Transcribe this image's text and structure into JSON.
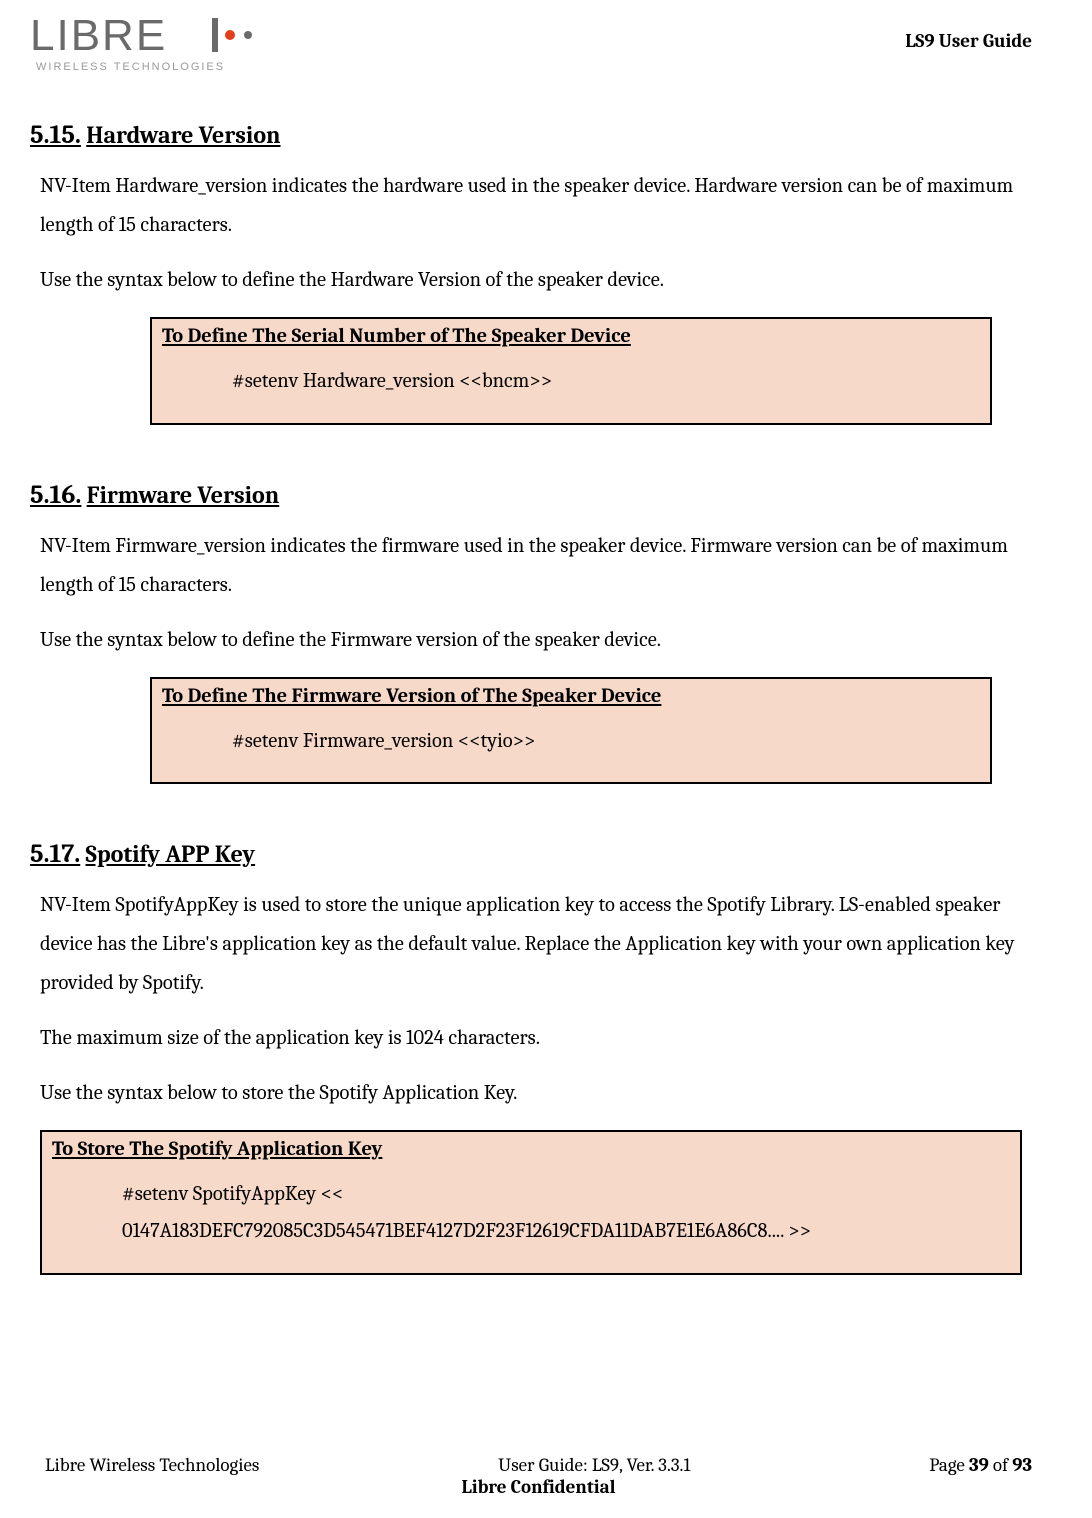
{
  "header": {
    "doc_title": "LS9 User Guide",
    "logo_text_main": "LIBRE",
    "logo_text_sub": "WIRELESS TECHNOLOGIES"
  },
  "sections": {
    "s515": {
      "num": "5.15.",
      "title": "Hardware Version",
      "para1": "NV-Item Hardware_version indicates the hardware used in the speaker device. Hardware version can be of maximum length of 15 characters.",
      "para2": "Use the syntax below to define the Hardware Version of the speaker device.",
      "box_title": "To Define The Serial Number of The Speaker Device",
      "box_cmd": "#setenv Hardware_version <<bncm>>"
    },
    "s516": {
      "num": "5.16.",
      "title": "Firmware Version",
      "para1": "NV-Item Firmware_version indicates the firmware used in the speaker device. Firmware version can be of maximum length of 15 characters.",
      "para2": "Use the syntax below to define the Firmware version  of the speaker device.",
      "box_title": "To Define The Firmware Version  of The Speaker Device",
      "box_cmd": "#setenv Firmware_version <<tyio>>"
    },
    "s517": {
      "num": "5.17.",
      "title": "Spotify APP Key",
      "para1": "NV-Item SpotifyAppKey is used to store the unique application key to access the Spotify Library. LS-enabled speaker device has the Libre's application key as the default value. Replace the Application key with your own application key provided by Spotify.",
      "para2": "The maximum size of the application key is 1024 characters.",
      "para3": "Use the syntax below to store the Spotify Application Key.",
      "box_title": "To Store The Spotify Application Key",
      "box_cmd_l1": "#setenv SpotifyAppKey <<",
      "box_cmd_l2": "0147A183DEFC792085C3D545471BEF4127D2F23F12619CFDA11DAB7E1E6A86C8.... >>"
    }
  },
  "footer": {
    "left": "Libre Wireless Technologies",
    "center": "User Guide: LS9, Ver. 3.3.1",
    "right_prefix": "Page ",
    "page_num": "39",
    "of_text": " of ",
    "total": "93",
    "confidential": "Libre Confidential"
  }
}
